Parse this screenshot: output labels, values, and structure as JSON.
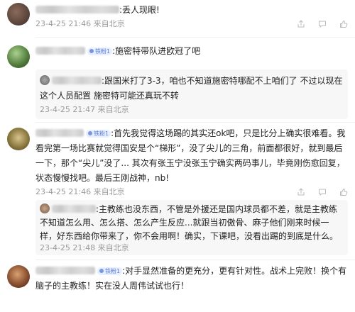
{
  "comments": [
    {
      "text": ":丢人现眼!",
      "meta": "23-4-25 21:46 来自北京"
    },
    {
      "badge": "铁粉1",
      "text": ":施密特带队进欧冠了吧",
      "reply": {
        "text": ":跟国米打了3-3，咱也不知道施密特哪配不上咱们了 不过以现在这个人员配置 施密特可能还真玩不转",
        "meta": "23-4-25 21:47 来自北京"
      }
    },
    {
      "badge": "铁粉1",
      "text": ":首先我觉得这场踢的其实还ok吧，只是比分上确实很难看。我看完第一场比赛就觉得国安是个“梯形”，没了尖儿的三角，前面都很好，就到最后一下，那个“尖儿”没了... 其次有张玉宁没张玉宁确实两码事儿，毕竟刚伤愈回复，状态慢慢找吧。最后王刚战神，nb!",
      "meta": "23-4-25 21:46 来自北京",
      "reply": {
        "text": ":主教练也没东西，不管是外援还是国内球员都不差，就是主教练不知道怎么用、怎么搭、怎么产生反应...就跟当初傲骨、麻子他们刚来时候一样，好东西给你带来了，你不会用啊！确实，下课吧，没看出踢的到底是什么。",
        "meta": "23-4-25 21:48 来自北京"
      }
    },
    {
      "badge": "铁粉1",
      "text": ":对手显然准备的更充分，更有针对性。战术上完败！换个有脑子的主教练！实在没人周伟试试也行！"
    }
  ]
}
